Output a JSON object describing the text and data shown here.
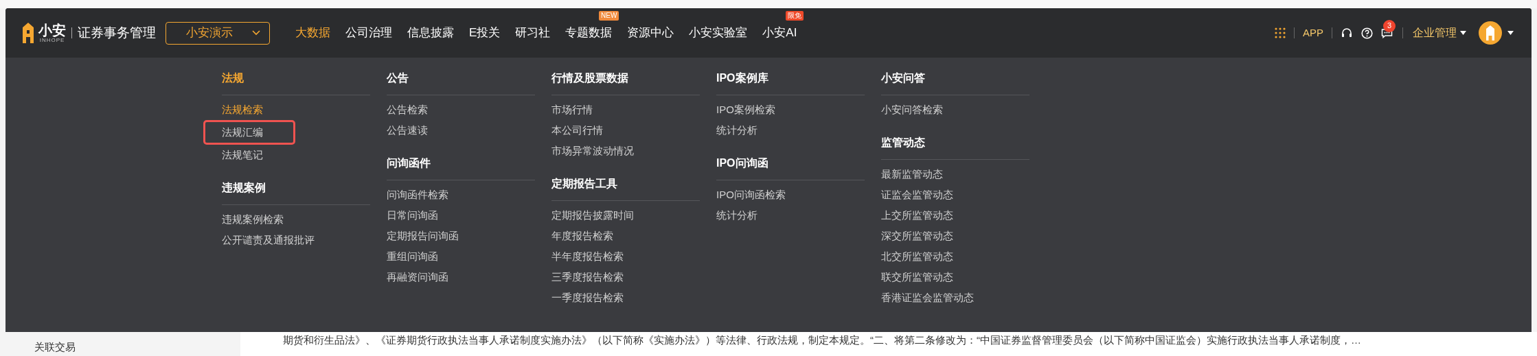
{
  "logo": {
    "name": "小安",
    "sub": "INHOPE"
  },
  "app_title": "证券事务管理",
  "org_select": {
    "value": "小安演示"
  },
  "nav": [
    {
      "label": "大数据",
      "selected": true
    },
    {
      "label": "公司治理",
      "selected": false
    },
    {
      "label": "信息披露",
      "selected": false
    },
    {
      "label": "E投关",
      "selected": false
    },
    {
      "label": "研习社",
      "selected": false
    },
    {
      "label": "专题数据",
      "selected": false,
      "badge": {
        "text": "NEW",
        "color": "#f08a3c"
      }
    },
    {
      "label": "资源中心",
      "selected": false
    },
    {
      "label": "小安实验室",
      "selected": false
    },
    {
      "label": "小安AI",
      "selected": false,
      "badge": {
        "text": "限免",
        "color": "#ef4a2a"
      }
    }
  ],
  "toolbar": {
    "app_link": "APP",
    "notification_count": "3",
    "enterprise_menu": "企业管理"
  },
  "mega_menu": {
    "columns": [
      {
        "sections": [
          {
            "title": "法规",
            "selected": true,
            "items": [
              {
                "label": "法规检索",
                "selected": true,
                "highlighted": false
              },
              {
                "label": "法规汇编",
                "selected": false,
                "highlighted": true
              },
              {
                "label": "法规笔记",
                "selected": false,
                "highlighted": false
              }
            ]
          },
          {
            "title": "违规案例",
            "selected": false,
            "items": [
              {
                "label": "违规案例检索",
                "selected": false,
                "highlighted": false
              },
              {
                "label": "公开谴责及通报批评",
                "selected": false,
                "highlighted": false
              }
            ]
          }
        ]
      },
      {
        "sections": [
          {
            "title": "公告",
            "selected": false,
            "items": [
              {
                "label": "公告检索",
                "selected": false,
                "highlighted": false
              },
              {
                "label": "公告速读",
                "selected": false,
                "highlighted": false
              }
            ]
          },
          {
            "title": "问询函件",
            "selected": false,
            "items": [
              {
                "label": "问询函件检索",
                "selected": false,
                "highlighted": false
              },
              {
                "label": "日常问询函",
                "selected": false,
                "highlighted": false
              },
              {
                "label": "定期报告问询函",
                "selected": false,
                "highlighted": false
              },
              {
                "label": "重组问询函",
                "selected": false,
                "highlighted": false
              },
              {
                "label": "再融资问询函",
                "selected": false,
                "highlighted": false
              }
            ]
          }
        ]
      },
      {
        "sections": [
          {
            "title": "行情及股票数据",
            "selected": false,
            "items": [
              {
                "label": "市场行情",
                "selected": false,
                "highlighted": false
              },
              {
                "label": "本公司行情",
                "selected": false,
                "highlighted": false
              },
              {
                "label": "市场异常波动情况",
                "selected": false,
                "highlighted": false
              }
            ]
          },
          {
            "title": "定期报告工具",
            "selected": false,
            "items": [
              {
                "label": "定期报告披露时间",
                "selected": false,
                "highlighted": false
              },
              {
                "label": "年度报告检索",
                "selected": false,
                "highlighted": false
              },
              {
                "label": "半年度报告检索",
                "selected": false,
                "highlighted": false
              },
              {
                "label": "三季度报告检索",
                "selected": false,
                "highlighted": false
              },
              {
                "label": "一季度报告检索",
                "selected": false,
                "highlighted": false
              }
            ]
          }
        ]
      },
      {
        "sections": [
          {
            "title": "IPO案例库",
            "selected": false,
            "items": [
              {
                "label": "IPO案例检索",
                "selected": false,
                "highlighted": false
              },
              {
                "label": "统计分析",
                "selected": false,
                "highlighted": false
              }
            ]
          },
          {
            "title": "IPO问询函",
            "selected": false,
            "items": [
              {
                "label": "IPO问询函检索",
                "selected": false,
                "highlighted": false
              },
              {
                "label": "统计分析",
                "selected": false,
                "highlighted": false
              }
            ]
          }
        ]
      },
      {
        "sections": [
          {
            "title": "小安问答",
            "selected": false,
            "items": [
              {
                "label": "小安问答检索",
                "selected": false,
                "highlighted": false
              }
            ]
          },
          {
            "title": "监管动态",
            "selected": false,
            "items": [
              {
                "label": "最新监管动态",
                "selected": false,
                "highlighted": false
              },
              {
                "label": "证监会监管动态",
                "selected": false,
                "highlighted": false
              },
              {
                "label": "上交所监管动态",
                "selected": false,
                "highlighted": false
              },
              {
                "label": "深交所监管动态",
                "selected": false,
                "highlighted": false
              },
              {
                "label": "北交所监管动态",
                "selected": false,
                "highlighted": false
              },
              {
                "label": "联交所监管动态",
                "selected": false,
                "highlighted": false
              },
              {
                "label": "香港证监会监管动态",
                "selected": false,
                "highlighted": false
              }
            ]
          }
        ]
      }
    ]
  },
  "page": {
    "sidebar_item": "关联交易",
    "body_text": "期货和衍生品法》、《证券期货行政执法当事人承诺制度实施办法》（以下简称《实施办法》）等法律、行政法规，制定本规定。“二、将第二条修改为：“中国证券监督管理委员会（以下简称中国证监会）实施行政执法当事人承诺制度，…"
  }
}
